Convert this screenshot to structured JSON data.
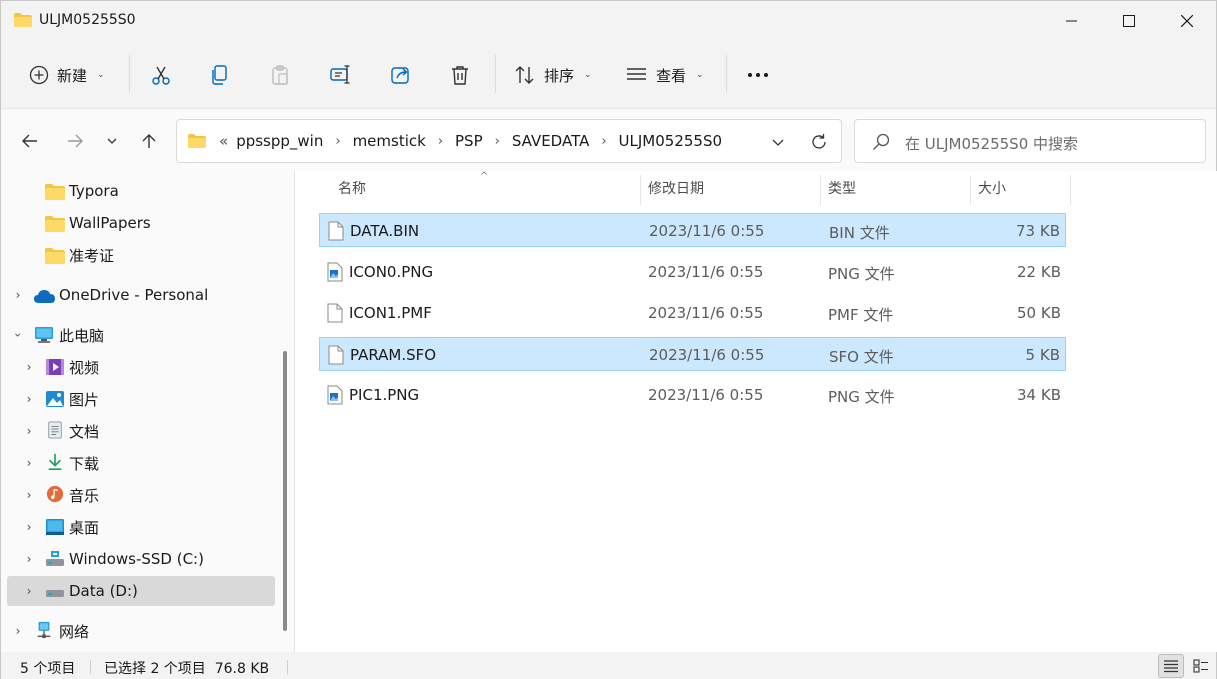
{
  "window": {
    "title": "ULJM05255S0"
  },
  "toolbar": {
    "new_label": "新建",
    "sort_label": "排序",
    "view_label": "查看"
  },
  "address": {
    "overflow": "«",
    "crumbs": [
      "ppsspp_win",
      "memstick",
      "PSP",
      "SAVEDATA",
      "ULJM05255S0"
    ]
  },
  "search": {
    "placeholder": "在 ULJM05255S0 中搜索"
  },
  "sidebar": {
    "items": [
      {
        "label": "Typora",
        "icon": "folder-icon"
      },
      {
        "label": "WallPapers",
        "icon": "folder-icon"
      },
      {
        "label": "准考证",
        "icon": "folder-icon"
      },
      {
        "label": "OneDrive - Personal",
        "icon": "cloud-icon"
      },
      {
        "label": "此电脑",
        "icon": "computer-icon"
      },
      {
        "label": "视频",
        "icon": "video-icon"
      },
      {
        "label": "图片",
        "icon": "pictures-icon"
      },
      {
        "label": "文档",
        "icon": "documents-icon"
      },
      {
        "label": "下载",
        "icon": "download-icon"
      },
      {
        "label": "音乐",
        "icon": "music-icon"
      },
      {
        "label": "桌面",
        "icon": "desktop-icon"
      },
      {
        "label": "Windows-SSD (C:)",
        "icon": "drive-icon"
      },
      {
        "label": "Data (D:)",
        "icon": "drive-icon"
      },
      {
        "label": "网络",
        "icon": "network-icon"
      }
    ]
  },
  "columns": {
    "name": "名称",
    "date": "修改日期",
    "type": "类型",
    "size": "大小"
  },
  "files": [
    {
      "name": "DATA.BIN",
      "date": "2023/11/6 0:55",
      "type": "BIN 文件",
      "size": "73 KB",
      "selected": true,
      "icon": "file-icon"
    },
    {
      "name": "ICON0.PNG",
      "date": "2023/11/6 0:55",
      "type": "PNG 文件",
      "size": "22 KB",
      "selected": false,
      "icon": "image-file-icon"
    },
    {
      "name": "ICON1.PMF",
      "date": "2023/11/6 0:55",
      "type": "PMF 文件",
      "size": "50 KB",
      "selected": false,
      "icon": "file-icon"
    },
    {
      "name": "PARAM.SFO",
      "date": "2023/11/6 0:55",
      "type": "SFO 文件",
      "size": "5 KB",
      "selected": true,
      "icon": "file-icon"
    },
    {
      "name": "PIC1.PNG",
      "date": "2023/11/6 0:55",
      "type": "PNG 文件",
      "size": "34 KB",
      "selected": false,
      "icon": "image-file-icon"
    }
  ],
  "status": {
    "count": "5 个项目",
    "selection": "已选择 2 个项目  76.8 KB"
  },
  "colors": {
    "selection_bg": "#cce8ff",
    "selection_border": "#99d1ff",
    "folder": "#f4c542",
    "accent": "#0067c0"
  }
}
